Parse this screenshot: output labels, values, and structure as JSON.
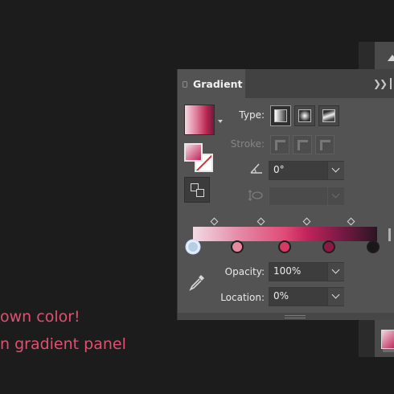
{
  "caption": {
    "line1": "own color!",
    "line2": "n gradient panel"
  },
  "panel": {
    "title": "Gradient",
    "type_label": "Type:",
    "stroke_label": "Stroke:",
    "angle_value": "0°",
    "aspect_value": "",
    "opacity_label": "Opacity:",
    "opacity_value": "100%",
    "location_label": "Location:",
    "location_value": "0%",
    "selected_type": "linear"
  },
  "gradient": {
    "stops": [
      {
        "position": 0,
        "color": "#b7cde0",
        "selected": true
      },
      {
        "position": 23.8,
        "color": "#e8899f",
        "selected": false
      },
      {
        "position": 49.7,
        "color": "#d63a62",
        "selected": false
      },
      {
        "position": 74.0,
        "color": "#8a1a43",
        "selected": false
      },
      {
        "position": 97.6,
        "color": "#1b1618",
        "selected": false
      }
    ],
    "midpoints": [
      12,
      37,
      62,
      86
    ]
  },
  "colors": {
    "accent_text": "#e0506f",
    "panel_bg": "#535353"
  }
}
